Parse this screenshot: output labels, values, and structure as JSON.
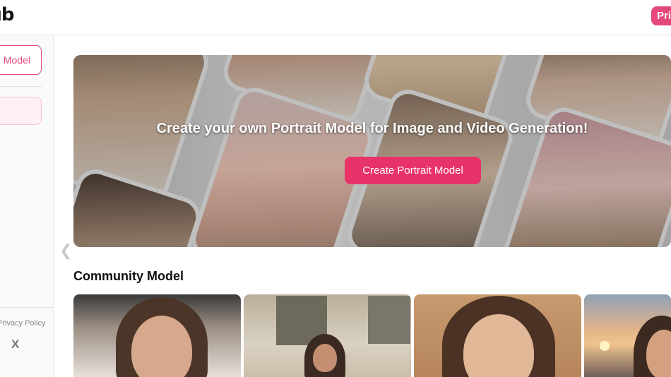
{
  "header": {
    "logo_text": "ıb",
    "pricing_label": "Pri"
  },
  "sidebar": {
    "model_button_label": "Model",
    "privacy_label": "Privacy Policy",
    "x_label": "X"
  },
  "banner": {
    "title": "Create your own Portrait Model for Image and Video Generation!",
    "button_label": "Create Portrait Model",
    "prev_arrow": "❮"
  },
  "community": {
    "title": "Community Model",
    "cards": [
      {
        "name": "community-card-1"
      },
      {
        "name": "community-card-2"
      },
      {
        "name": "community-card-3"
      },
      {
        "name": "community-card-4"
      }
    ]
  },
  "colors": {
    "accent": "#e8336a",
    "accent_soft": "#fff0f4",
    "border": "#e5e5e5"
  }
}
